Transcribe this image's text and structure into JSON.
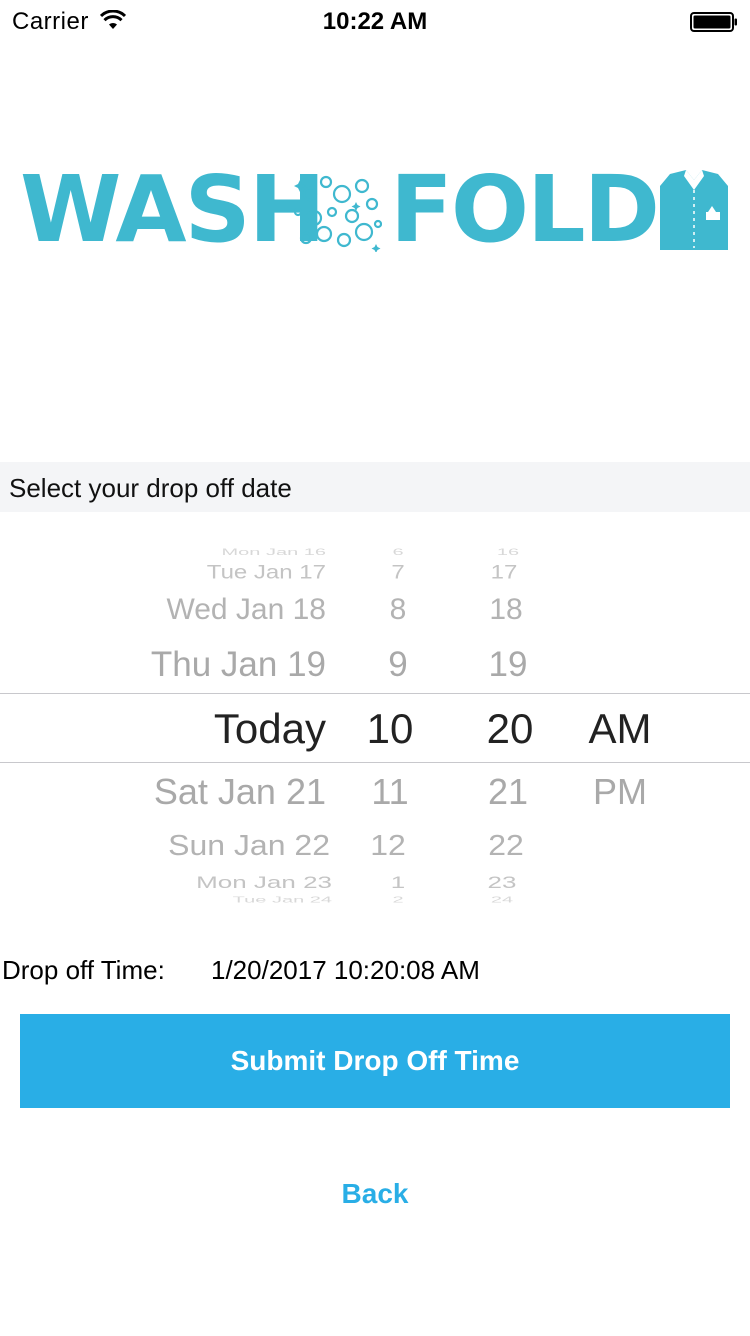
{
  "status_bar": {
    "carrier": "Carrier",
    "time": "10:22 AM",
    "icons": [
      "wifi-icon",
      "battery-icon"
    ]
  },
  "logo": {
    "word_left": "WASH",
    "word_right": "FOLD",
    "color": "#3fb8cf",
    "icons": [
      "bubbles-icon",
      "shirt-icon"
    ]
  },
  "section_header": {
    "title": "Select your drop off date",
    "background": "#f4f5f7"
  },
  "picker": {
    "date_column": [
      "Mon Jan 16",
      "Tue Jan 17",
      "Wed Jan 18",
      "Thu Jan 19",
      "Today",
      "Sat Jan 21",
      "Sun Jan 22",
      "Mon Jan 23",
      "Tue Jan 24"
    ],
    "hour_column": [
      "6",
      "7",
      "8",
      "9",
      "10",
      "11",
      "12",
      "1",
      "2"
    ],
    "minute_column": [
      "16",
      "17",
      "18",
      "19",
      "20",
      "21",
      "22",
      "23",
      "24"
    ],
    "ampm_column": [
      "",
      "",
      "",
      "",
      "AM",
      "PM",
      "",
      "",
      ""
    ],
    "selected": {
      "date": "Today",
      "hour": "10",
      "minute": "20",
      "ampm": "AM"
    }
  },
  "dropoff": {
    "label": "Drop off Time:",
    "value": "1/20/2017 10:20:08 AM"
  },
  "actions": {
    "submit_label": "Submit Drop Off Time",
    "back_label": "Back",
    "accent": "#29aee6"
  }
}
